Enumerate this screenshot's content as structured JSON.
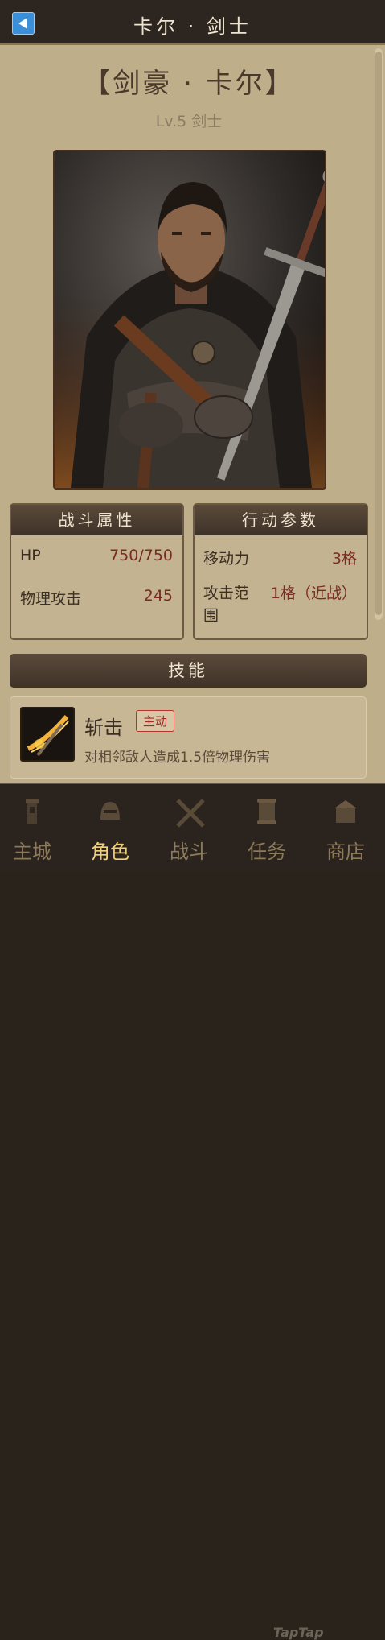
{
  "header": {
    "title": "卡尔 · 剑士"
  },
  "character": {
    "name": "【剑豪 · 卡尔】",
    "subtitle": "Lv.5  剑士"
  },
  "combat_stats": {
    "heading": "战斗属性",
    "rows": [
      {
        "label": "HP",
        "value": "750/750"
      },
      {
        "label": "物理攻击",
        "value": "245"
      }
    ]
  },
  "action_params": {
    "heading": "行动参数",
    "rows": [
      {
        "label": "移动力",
        "value": "3格"
      },
      {
        "label": "攻击范围",
        "value": "1格（近战）"
      }
    ]
  },
  "skills": {
    "heading": "技能",
    "items": [
      {
        "name": "斩击",
        "tag": "主动",
        "description": "对相邻敌人造成1.5倍物理伤害"
      }
    ]
  },
  "nav": {
    "items": [
      {
        "label": "主城",
        "icon": "tower-icon"
      },
      {
        "label": "角色",
        "icon": "helmet-icon"
      },
      {
        "label": "战斗",
        "icon": "crossed-swords-icon"
      },
      {
        "label": "任务",
        "icon": "scroll-icon"
      },
      {
        "label": "商店",
        "icon": "shop-icon"
      }
    ],
    "active_index": 1
  },
  "watermark": "TapTap",
  "colors": {
    "accent_active": "#f0d07a",
    "value_red": "#7a2a22",
    "back_button": "#3b8fd8"
  }
}
